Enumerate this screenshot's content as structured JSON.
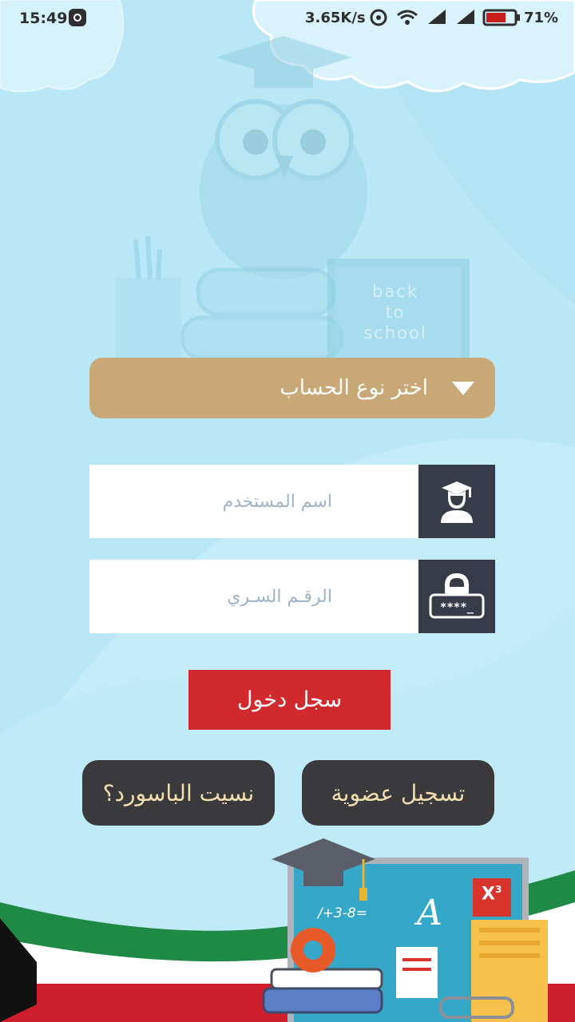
{
  "status_bar": {
    "time": "15:49",
    "network_speed": "3.65K/s",
    "battery_percent": "71%",
    "battery_level": 0.71,
    "icons": [
      "app-notification-icon",
      "hotspot-icon",
      "wifi-icon",
      "signal-icon",
      "signal-icon",
      "battery-icon"
    ]
  },
  "background": {
    "chalkboard_text": [
      "back",
      "to",
      "school"
    ],
    "math_text": "/+3-8=",
    "grade_text": "A",
    "power_text": "X",
    "power_sup": "3"
  },
  "account_type": {
    "label": "اختر نوع الحساب",
    "icon": "chevron-down-icon"
  },
  "username": {
    "placeholder": "اسم المستخدم",
    "value": "",
    "icon": "graduate-icon"
  },
  "password": {
    "placeholder": "الرقـم السـري",
    "value": "",
    "icon": "password-lock-icon",
    "icon_text": "****_"
  },
  "login_button": {
    "label": "سجل دخول"
  },
  "register_button": {
    "label": "تسجيل عضوية"
  },
  "forgot_button": {
    "label": "نسيت الباسورد؟"
  },
  "colors": {
    "background": "#c3ecf8",
    "accent_gold": "#c8a877",
    "login_red": "#d12a2e",
    "dark_button": "#3a3a3c",
    "button_text": "#f2deb0",
    "icon_box": "#363b48"
  }
}
